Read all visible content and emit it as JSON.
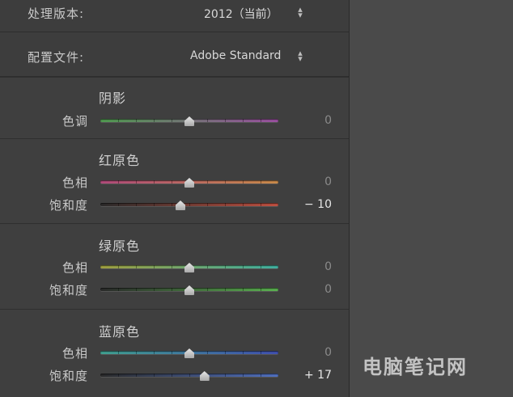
{
  "process_version": {
    "label": "处理版本:",
    "value": "2012（当前）",
    "arrows": "⇕"
  },
  "profile": {
    "label": "配置文件:",
    "value": "Adobe Standard",
    "arrows": "⇕"
  },
  "shadows": {
    "title": "阴影",
    "tint": {
      "label": "色调",
      "value": "0",
      "position": 0.5
    }
  },
  "red_primary": {
    "title": "红原色",
    "hue": {
      "label": "色相",
      "value": "0",
      "position": 0.5
    },
    "saturation": {
      "label": "饱和度",
      "value": "− 10",
      "position": 0.45
    }
  },
  "green_primary": {
    "title": "绿原色",
    "hue": {
      "label": "色相",
      "value": "0",
      "position": 0.5
    },
    "saturation": {
      "label": "饱和度",
      "value": "0",
      "position": 0.5
    }
  },
  "blue_primary": {
    "title": "蓝原色",
    "hue": {
      "label": "色相",
      "value": "0",
      "position": 0.5
    },
    "saturation": {
      "label": "饱和度",
      "value": "+ 17",
      "position": 0.585
    }
  },
  "watermark": "电脑笔记网",
  "colors": {
    "panel_bg": "#3f3f3f",
    "page_bg": "#4a4a4a",
    "track_shadow_tint": [
      "#4f9a4f",
      "#9a4fa0"
    ],
    "track_red_hue": [
      "#b04a7a",
      "#c88a4a"
    ],
    "track_red_sat": [
      "#2a2a2a",
      "#c05040"
    ],
    "track_green_hue": [
      "#a0a040",
      "#40b0a0"
    ],
    "track_green_sat": [
      "#2a2a2a",
      "#5ab050"
    ],
    "track_blue_hue": [
      "#40a090",
      "#4050b0"
    ],
    "track_blue_sat": [
      "#2a2a2a",
      "#5070c0"
    ]
  }
}
